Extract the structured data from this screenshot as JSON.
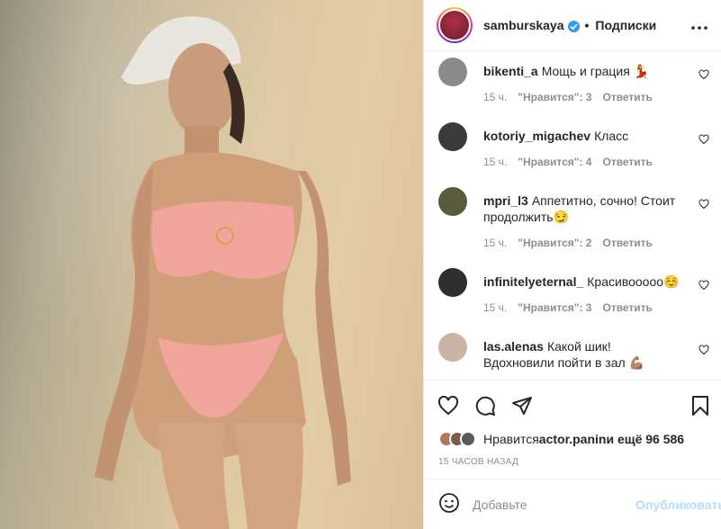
{
  "post": {
    "image_alt": "photo",
    "header": {
      "username": "samburskaya",
      "separator": "•",
      "follow_label": "Подписки",
      "more_label": "•••"
    },
    "comments": [
      {
        "username": "bikenti_a",
        "text": "Мощь и грация 💃",
        "time": "15 ч.",
        "likes": "\"Нравится\": 3",
        "reply": "Ответить",
        "avatar_color": "#7a7a7a"
      },
      {
        "username": "kotoriy_migachev",
        "text": "Класс",
        "time": "15 ч.",
        "likes": "\"Нравится\": 4",
        "reply": "Ответить",
        "avatar_color": "#3b3b3b"
      },
      {
        "username": "mpri_l3",
        "text": "Аппетитно, сочно! Стоит продолжить😏",
        "time": "15 ч.",
        "likes": "\"Нравится\": 2",
        "reply": "Ответить",
        "avatar_color": "#5a5a3c"
      },
      {
        "username": "infinitelyeternal_",
        "text": "Красивооооо☺️",
        "time": "15 ч.",
        "likes": "\"Нравится\": 3",
        "reply": "Ответить",
        "avatar_color": "#2e2e2e"
      },
      {
        "username": "las.alenas",
        "text": "Какой шик! Вдохновили пойти в зал 💪🏽",
        "time": "",
        "likes": "",
        "reply": "",
        "avatar_color": "#c9b4a6"
      }
    ],
    "liked_by": {
      "prefix": "Нравится ",
      "user": "actor.panin",
      "suffix": " и ещё 96 586"
    },
    "time_ago": "15 ЧАСОВ НАЗАД",
    "add_comment": {
      "placeholder": "Добавьте",
      "publish_label": "Опубликовать"
    }
  },
  "colors": {
    "link_blue": "#0095f6",
    "publish_disabled": "#b2dffc",
    "meta_grey": "#8e8e8e"
  },
  "icons": [
    "heart-icon",
    "comment-icon",
    "share-icon",
    "bookmark-icon",
    "emoji-icon",
    "verified-icon",
    "more-icon"
  ]
}
